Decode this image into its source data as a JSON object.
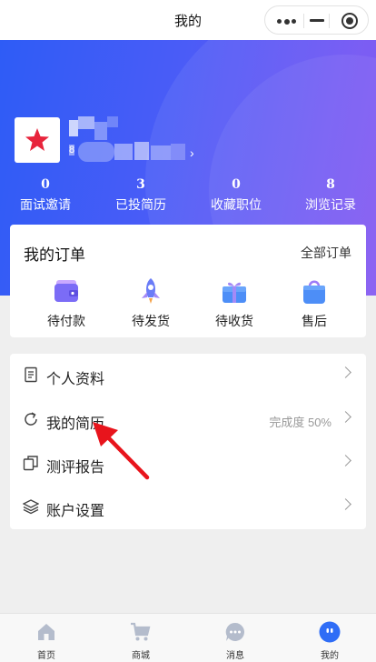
{
  "page": {
    "title": "我的"
  },
  "capsule": {
    "more_icon": "more-dots-icon",
    "minimize_icon": "minimize-icon",
    "close_icon": "target-icon"
  },
  "profile": {
    "avatar_icon": "red-star-icon",
    "name_visible": "灵",
    "id_prefix": "8",
    "colors": {
      "brand_start": "#2d5cf6",
      "brand_end": "#7d4ef2",
      "star": "#e8243c"
    }
  },
  "stats": [
    {
      "value": "0",
      "label": "面试邀请"
    },
    {
      "value": "3",
      "label": "已投简历"
    },
    {
      "value": "0",
      "label": "收藏职位"
    },
    {
      "value": "8",
      "label": "浏览记录"
    }
  ],
  "orders": {
    "title": "我的订单",
    "all_label": "全部订单",
    "items": [
      {
        "label": "待付款",
        "icon": "wallet-icon"
      },
      {
        "label": "待发货",
        "icon": "rocket-icon"
      },
      {
        "label": "待收货",
        "icon": "gift-box-icon"
      },
      {
        "label": "售后",
        "icon": "shopping-bag-icon"
      }
    ]
  },
  "menu": [
    {
      "label": "个人资料",
      "icon": "document-icon",
      "extra": ""
    },
    {
      "label": "我的简历",
      "icon": "refresh-icon",
      "extra": "完成度 50%"
    },
    {
      "label": "测评报告",
      "icon": "copy-icon",
      "extra": ""
    },
    {
      "label": "账户设置",
      "icon": "layers-icon",
      "extra": ""
    }
  ],
  "annotation": {
    "arrow_color": "#e8141c"
  },
  "tabs": [
    {
      "label": "首页",
      "icon": "home-icon"
    },
    {
      "label": "商城",
      "icon": "cart-icon"
    },
    {
      "label": "消息",
      "icon": "chat-icon"
    },
    {
      "label": "我的",
      "icon": "profile-icon",
      "active": true
    }
  ]
}
